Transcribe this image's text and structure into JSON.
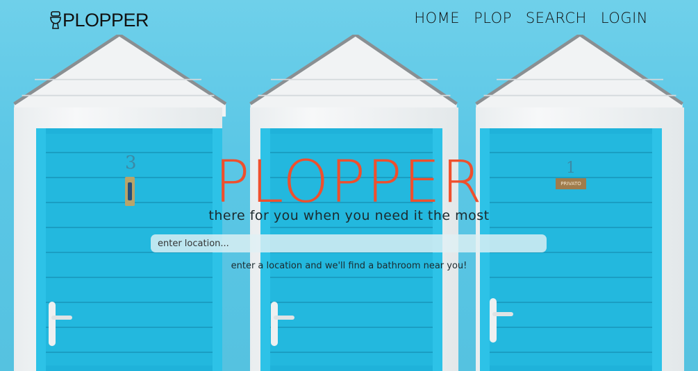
{
  "brand": {
    "logo_text": "PLOPPER",
    "logo_icon": "toilet-icon"
  },
  "nav": {
    "items": [
      "HOME",
      "PLOP",
      "SEARCH",
      "LOGIN"
    ]
  },
  "hero": {
    "title": "PLOPPER",
    "subtitle": "there for you when you need it the most",
    "search_placeholder": "enter location...",
    "hint": "enter a location and we'll find a bathroom near you!"
  },
  "background": {
    "cabin_numbers": [
      "3",
      "1"
    ],
    "sign_text": "PRIVATO"
  },
  "colors": {
    "accent": "#ef4f2d",
    "door_blue": "#23b8de",
    "sky": "#5ec8e6"
  }
}
